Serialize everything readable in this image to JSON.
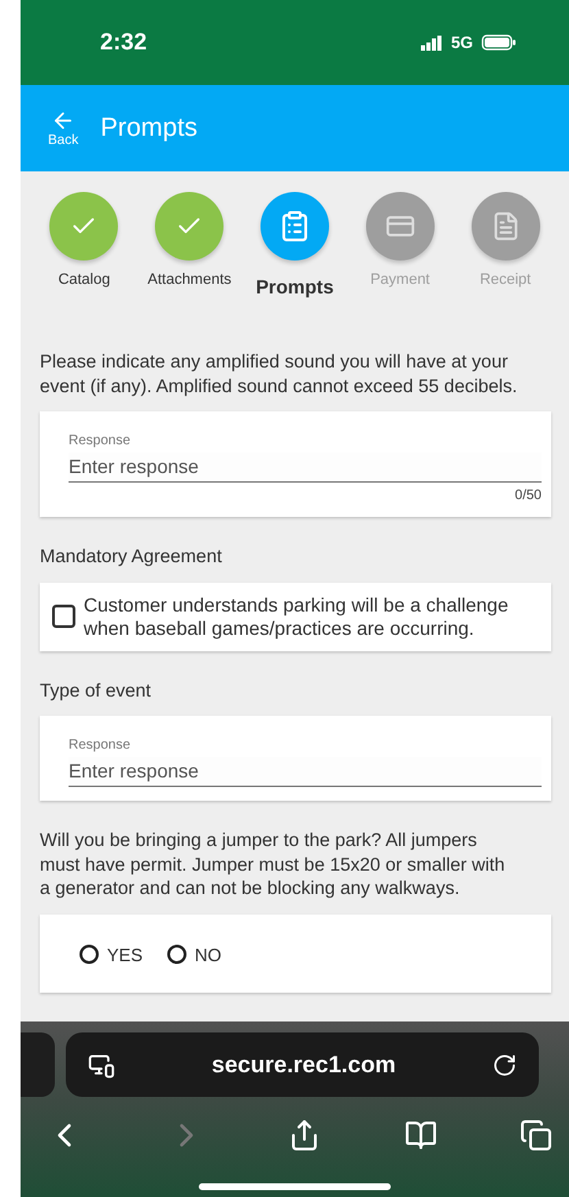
{
  "status_bar": {
    "time": "2:32",
    "network": "5G"
  },
  "app_bar": {
    "back_label": "Back",
    "title": "Prompts"
  },
  "steps": [
    {
      "label": "Catalog",
      "kind": "done",
      "selected": false
    },
    {
      "label": "Attachments",
      "kind": "done",
      "selected": false
    },
    {
      "label": "Prompts",
      "kind": "current",
      "selected": true
    },
    {
      "label": "Payment",
      "kind": "payment",
      "selected": false
    },
    {
      "label": "Receipt",
      "kind": "receipt",
      "selected": false
    }
  ],
  "prompts": [
    {
      "kind": "text",
      "question": "Please indicate any amplified sound you will have at your event (if any). Amplified sound cannot exceed 55 decibels.",
      "label": "Response",
      "placeholder": "Enter response",
      "counter": "0/50"
    },
    {
      "kind": "checkbox",
      "question": "Mandatory Agreement",
      "text": "Customer understands parking will be a challenge when baseball games/practices are occurring.",
      "checked": false
    },
    {
      "kind": "text",
      "question": "Type of event",
      "label": "Response",
      "placeholder": "Enter response"
    },
    {
      "kind": "radio",
      "question": "Will you be bringing a jumper to the park? All jumpers must have permit. Jumper must be 15x20 or smaller with a generator and can not be blocking any walkways.",
      "options": [
        {
          "label": "YES",
          "selected": false
        },
        {
          "label": "NO",
          "selected": false
        }
      ]
    }
  ],
  "browser": {
    "url": "secure.rec1.com",
    "forward_disabled": true
  }
}
